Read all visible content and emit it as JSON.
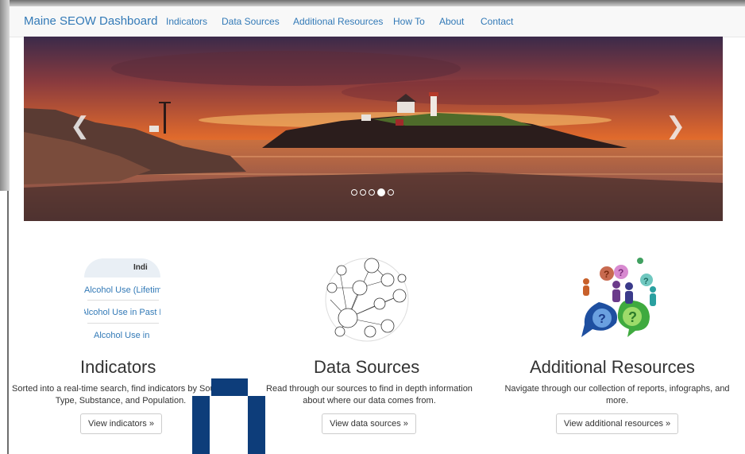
{
  "navbar": {
    "brand": "Maine SEOW Dashboard",
    "links": [
      "Indicators",
      "Data Sources",
      "Additional Resources",
      "How To",
      "About",
      "Contact"
    ]
  },
  "carousel": {
    "prev_icon": "chevron-left-icon",
    "next_icon": "chevron-right-icon",
    "slide_count": 5,
    "active_slide": 4
  },
  "features": [
    {
      "heading": "Indicators",
      "description": "Sorted into a real-time search, find indicators by Source, Type, Substance, and Population.",
      "button": "View indicators »",
      "thumbnail": {
        "header": "Indi",
        "rows": [
          "Alcohol Use (Lifetim",
          "Alcohol Use in Past M",
          "Alcohol Use in"
        ]
      }
    },
    {
      "heading": "Data Sources",
      "description": "Read through our sources to find in depth information about where our data comes from.",
      "button": "View data sources »",
      "thumbnail_icon": "network-diagram-icon"
    },
    {
      "heading": "Additional Resources",
      "description": "Navigate through our collection of reports, infographs, and more.",
      "button": "View additional resources »",
      "thumbnail_icon": "people-question-icon"
    }
  ],
  "colors": {
    "link": "#337ab7",
    "overlay_block": "#0d3d7a"
  }
}
